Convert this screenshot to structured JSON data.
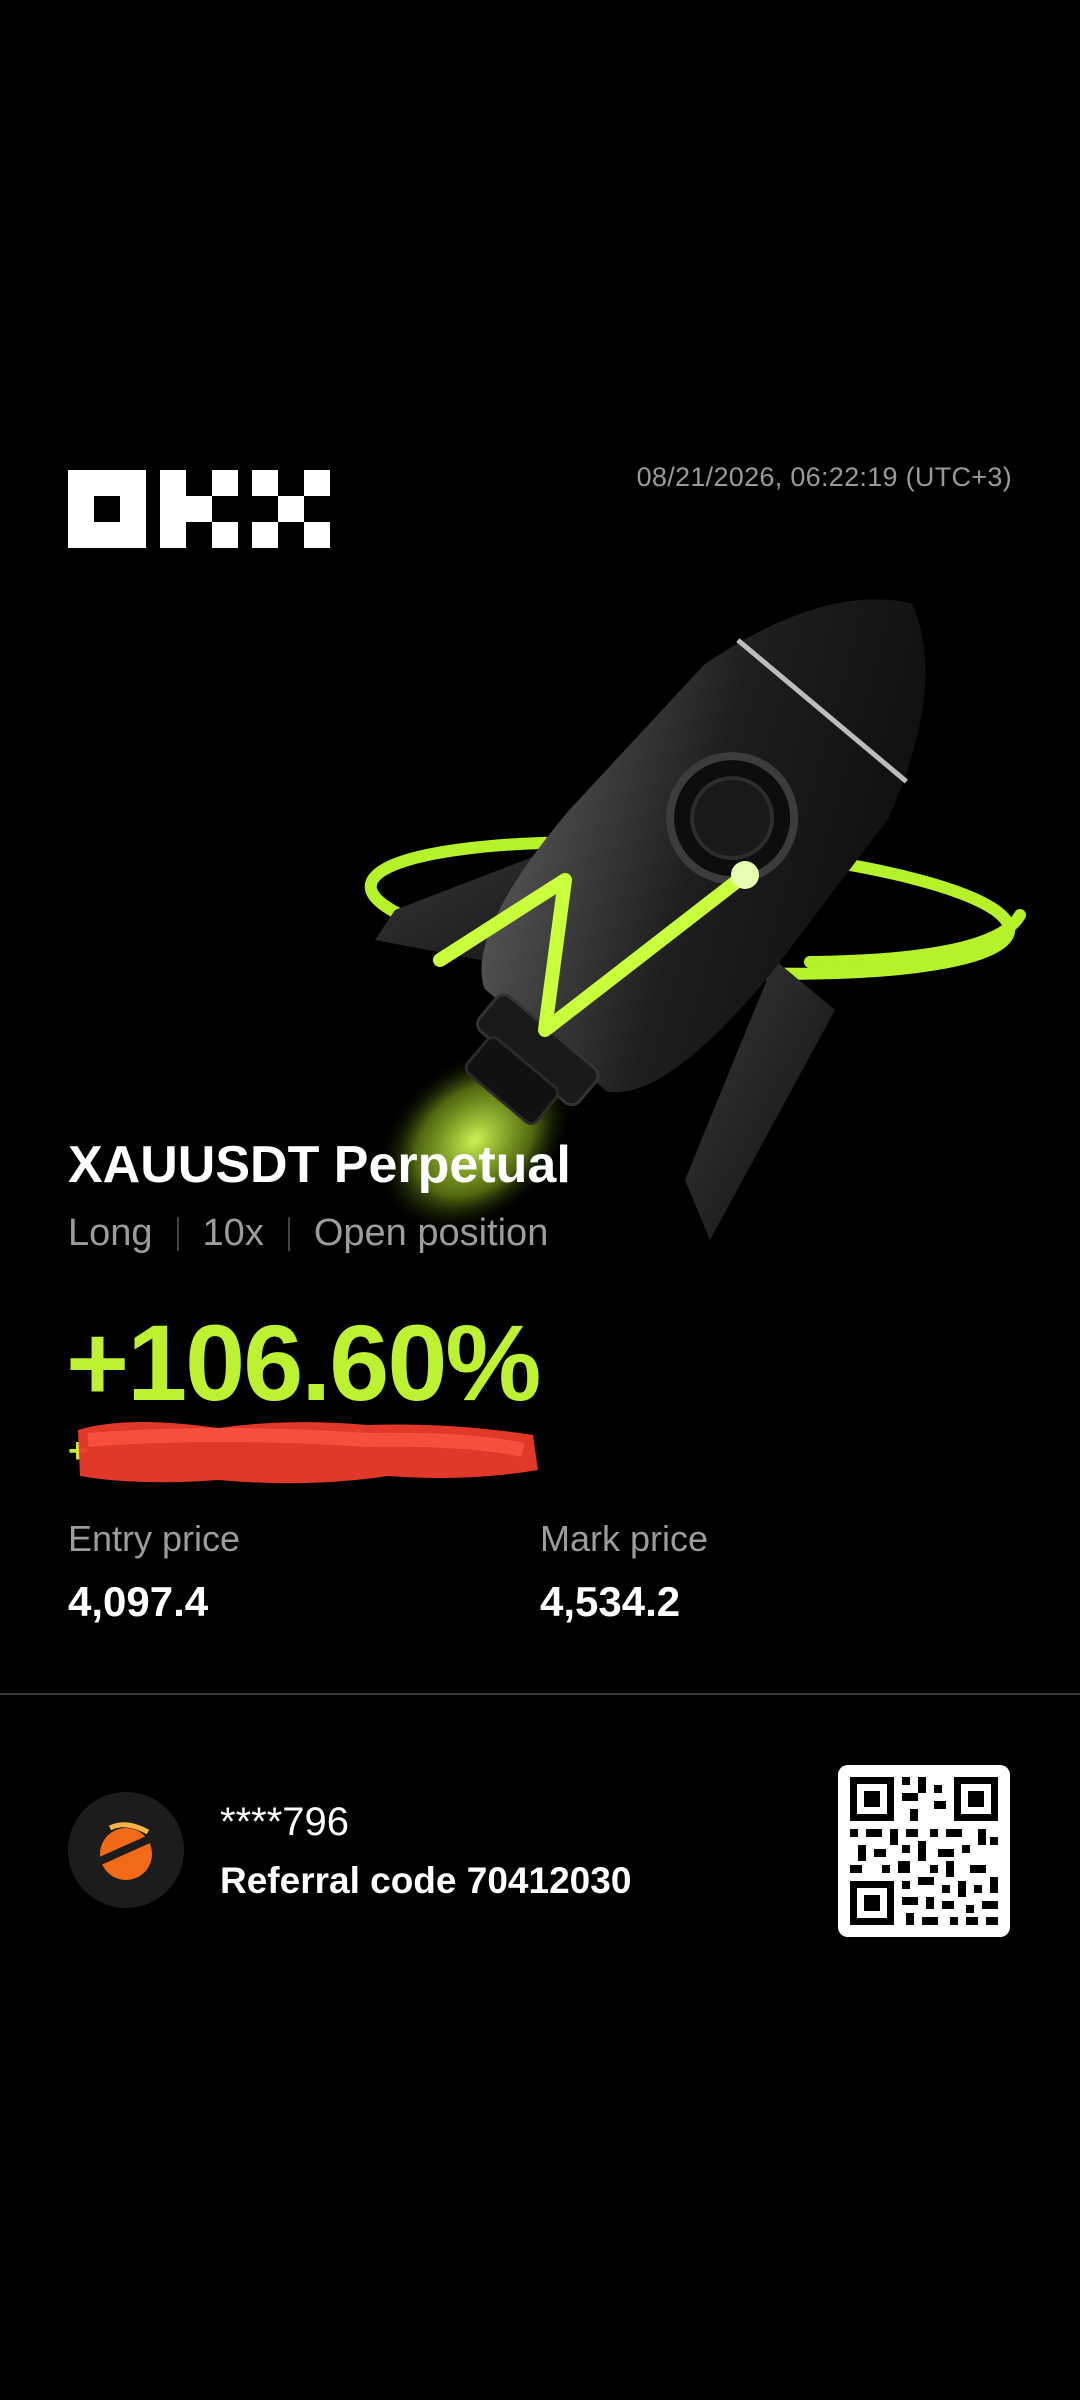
{
  "brand": {
    "logo_icon": "okx-logo"
  },
  "timestamp": "08/21/2026, 06:22:19 (UTC+3)",
  "hero": {
    "illustration": "rocket-illustration"
  },
  "position": {
    "instrument": "XAUUSDT Perpetual",
    "side": "Long",
    "leverage": "10x",
    "status": "Open position",
    "pnl_percent": "+106.60%",
    "pnl_amount_redacted": "+"
  },
  "prices": {
    "entry_label": "Entry price",
    "entry_value": "4,097.4",
    "mark_label": "Mark price",
    "mark_value": "4,534.2"
  },
  "user": {
    "masked_id": "****796",
    "referral": "Referral code 70412030",
    "avatar_icon": "avatar"
  },
  "qr": {
    "icon": "qr-code"
  },
  "colors": {
    "accent": "#bcf231",
    "background": "#000000",
    "muted": "#9c9c9c",
    "redaction": "#ee3b2b"
  }
}
